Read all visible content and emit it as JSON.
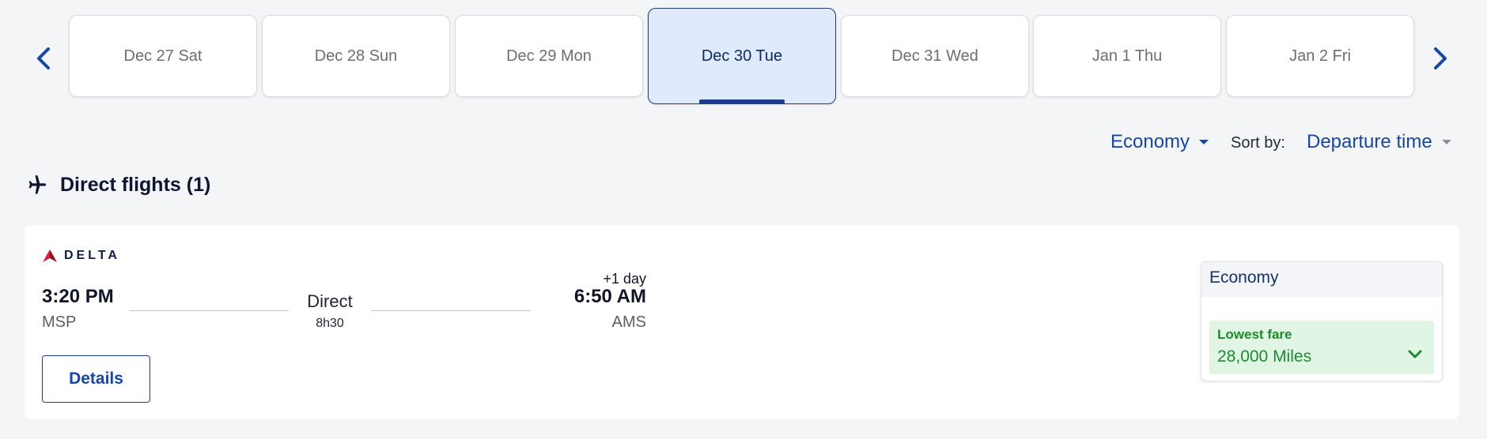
{
  "date_strip": {
    "dates": [
      {
        "label": "Dec 27 Sat"
      },
      {
        "label": "Dec 28 Sun"
      },
      {
        "label": "Dec 29 Mon"
      },
      {
        "label": "Dec 30 Tue",
        "selected": true
      },
      {
        "label": "Dec 31 Wed"
      },
      {
        "label": "Jan 1 Thu"
      },
      {
        "label": "Jan 2 Fri"
      }
    ],
    "prev_icon": "chevron-left-icon",
    "next_icon": "chevron-right-icon"
  },
  "filters": {
    "cabin": "Economy",
    "sort_label": "Sort by:",
    "sort_value": "Departure time"
  },
  "section": {
    "icon": "airplane-icon",
    "title": "Direct flights (1)"
  },
  "flight": {
    "airline": "DELTA",
    "departure_time": "3:20 PM",
    "departure_airport": "MSP",
    "stops": "Direct",
    "duration": "8h30",
    "day_offset": "+1 day",
    "arrival_time": "6:50 AM",
    "arrival_airport": "AMS",
    "details_label": "Details",
    "fare": {
      "cabin": "Economy",
      "label": "Lowest fare",
      "price": "28,000 Miles"
    }
  },
  "colors": {
    "accent_blue": "#1646a8",
    "selected_bg": "#dfeafc",
    "fare_green": "#1e8a2f",
    "fare_green_bg": "#e1f5e4",
    "delta_red": "#c8102e"
  }
}
